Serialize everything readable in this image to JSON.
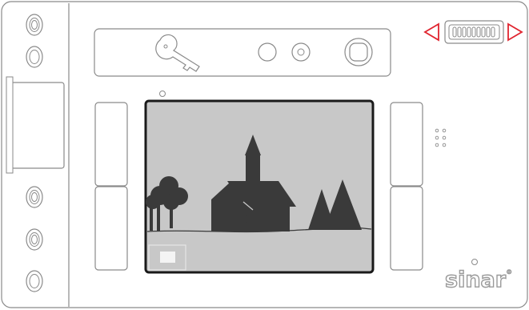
{
  "device": {
    "brand_logo": "sinar",
    "registered_mark": "®"
  },
  "controls": {
    "left_column_buttons": [
      "knob-top",
      "knob-2",
      "knob-3",
      "knob-4",
      "knob-5"
    ],
    "wheel_direction_left_color": "#e0242f",
    "wheel_direction_right_color": "#e0242f"
  },
  "preview": {
    "background_color": "#c8c8c8",
    "scene": "landscape-with-church-icon",
    "selection_box": true
  },
  "colors": {
    "outline": "#8a8a8a",
    "screen_border": "#1a1a1a",
    "silhouette": "#3a3a3a",
    "accent_red": "#e0242f"
  }
}
